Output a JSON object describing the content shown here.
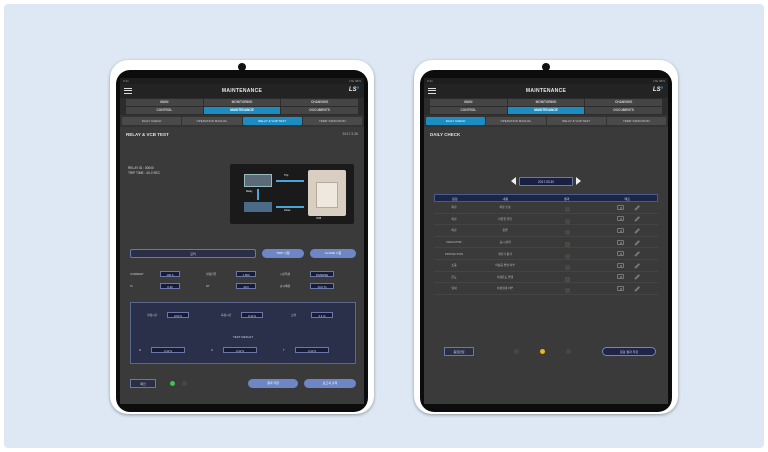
{
  "left_tablet": {
    "status": {
      "left": "9:41",
      "right": "LTE 98%"
    },
    "title": "MAINTENANCE",
    "logo": "LS",
    "nav": [
      "MAIN",
      "MONITORING",
      "CHANGING",
      "CONTROL",
      "MAINTENANCE",
      "DOCUMENTS"
    ],
    "nav_active": "MAINTENANCE",
    "subtabs": [
      "DAILY CHECK",
      "OPERATION MANUAL",
      "RELAY & VCB TEST",
      "TEMP. INDICATION"
    ],
    "subtab_active": "RELAY & VCB TEST",
    "section": {
      "title": "RELAY & VCB TEST",
      "date": "2017.3.30"
    },
    "relay_info": [
      "RELAY ID : 00000",
      "TRIP TIME : 40.0 SEC"
    ],
    "diagram_labels": {
      "trip": "Trip",
      "relay": "Relay",
      "vcb": "VCB",
      "close": "Close"
    },
    "controls": {
      "field": "모터",
      "btn1": "TRIP 시험",
      "btn2": "CLOSE 시험"
    },
    "params": [
      {
        "label": "CURRENT",
        "value": "100 A"
      },
      {
        "label": "설정전류",
        "value": "1,500"
      },
      {
        "label": "시간특성",
        "value": "INVERSE"
      },
      {
        "label": "Ts",
        "value": "0.20"
      },
      {
        "label": "DT",
        "value": "40.0"
      },
      {
        "label": "순시배율",
        "value": "10.0 Ts"
      }
    ],
    "test_top": [
      {
        "label": "설정시간",
        "value": "0.50 S"
      },
      {
        "label": "측정시간",
        "value": "0.42 S"
      },
      {
        "label": "오차",
        "value": "3.2 %"
      }
    ],
    "test_title": "TEST RESULT",
    "test_bottom": [
      {
        "label": "R",
        "value": "0.42 S"
      },
      {
        "label": "S",
        "value": "0.42 S"
      },
      {
        "label": "T",
        "value": "0.43 S"
      }
    ],
    "bottom": {
      "ok": "확인",
      "btn1": "결과 저장",
      "btn2": "보고서 출력"
    }
  },
  "right_tablet": {
    "status": {
      "left": "9:41",
      "right": "LTE 98%"
    },
    "title": "MAINTENANCE",
    "logo": "LS",
    "nav": [
      "MAIN",
      "MONITORING",
      "CHANGING",
      "CONTROL",
      "MAINTENANCE",
      "DOCUMENTS"
    ],
    "nav_active": "MAINTENANCE",
    "subtabs": [
      "DAILY CHECK",
      "OPERATION MANUAL",
      "RELAY & VCB TEST",
      "TEMP. INDICATION"
    ],
    "subtab_active": "DAILY CHECK",
    "section": {
      "title": "DAILY CHECK"
    },
    "date": "2017.03.30",
    "table_headers": [
      "점검",
      "내용",
      "결과",
      "메모"
    ],
    "rows": [
      {
        "item": "외관",
        "content": "외함 손상",
        "status": "green"
      },
      {
        "item": "외관",
        "content": "이물질 유입",
        "status": "green"
      },
      {
        "item": "외관",
        "content": "청결",
        "status": "green"
      },
      {
        "item": "INDICATOR",
        "content": "표시 상태",
        "status": "yellow"
      },
      {
        "item": "PROTECTION",
        "content": "계전기 동작",
        "status": "green"
      },
      {
        "item": "소음",
        "content": "이상음 발생 여부",
        "status": "green"
      },
      {
        "item": "온도",
        "content": "이상온도 발생",
        "status": "yellow"
      },
      {
        "item": "냄새",
        "content": "이상냄새 여부",
        "status": "green"
      }
    ],
    "summary_label": "종합판정",
    "save": "점검 결과 저장"
  },
  "colors": {
    "accent": "#1b8dc2",
    "ok": "#3fc24a",
    "warn": "#f0b21e",
    "button": "#6f86c6"
  }
}
